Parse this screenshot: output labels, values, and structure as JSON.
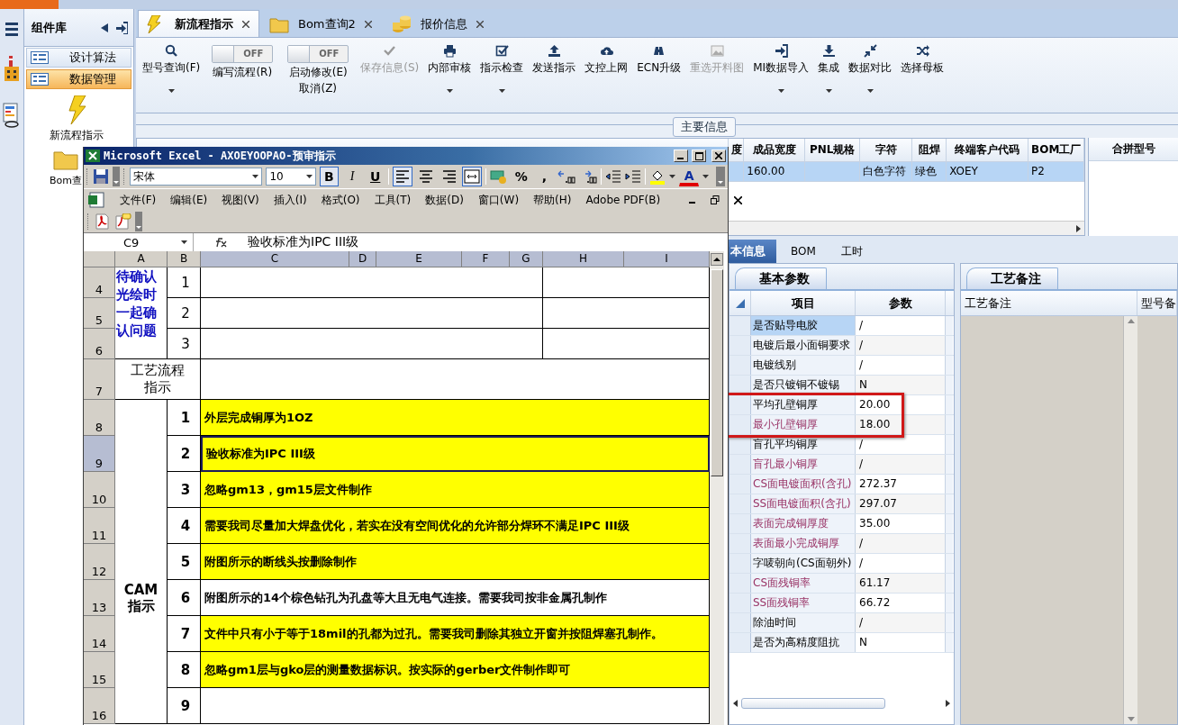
{
  "app_tabs": [
    {
      "label": "新流程指示",
      "selected": true
    },
    {
      "label": "Bom查询2",
      "selected": false
    },
    {
      "label": "报价信息",
      "selected": false
    }
  ],
  "sidebar": {
    "title": "组件库",
    "groups": [
      {
        "label": "设计算法",
        "selected": false
      },
      {
        "label": "数据管理",
        "selected": true
      }
    ],
    "items": [
      {
        "label": "新流程指示"
      },
      {
        "label": "Bom查"
      }
    ]
  },
  "ribbon": [
    {
      "kind": "button",
      "label": "型号查询(F)",
      "disabled": false,
      "dropdown": true
    },
    {
      "kind": "toggle",
      "label": "编写流程(R)",
      "state": "OFF",
      "on": false
    },
    {
      "kind": "toggle",
      "label": "启动修改(E)",
      "sublabel": "取消(Z)",
      "state": "OFF",
      "on": false
    },
    {
      "kind": "button",
      "label": "保存信息(S)",
      "disabled": true,
      "dropdown": false
    },
    {
      "kind": "button",
      "label": "内部审核",
      "disabled": false,
      "dropdown": true
    },
    {
      "kind": "button",
      "label": "指示检查",
      "disabled": false,
      "dropdown": true
    },
    {
      "kind": "button",
      "label": "发送指示",
      "disabled": false,
      "dropdown": false
    },
    {
      "kind": "button",
      "label": "文控上网",
      "disabled": false,
      "dropdown": false
    },
    {
      "kind": "button",
      "label": "ECN升级",
      "disabled": false,
      "dropdown": false
    },
    {
      "kind": "button",
      "label": "重选开料图",
      "disabled": true,
      "dropdown": false
    },
    {
      "kind": "button",
      "label": "MI数据导入",
      "disabled": false,
      "dropdown": true
    },
    {
      "kind": "button",
      "label": "集成",
      "disabled": false,
      "dropdown": true
    },
    {
      "kind": "button",
      "label": "数据对比",
      "disabled": false,
      "dropdown": true
    },
    {
      "kind": "button",
      "label": "选择母板",
      "disabled": false,
      "dropdown": false
    }
  ],
  "main_info": {
    "title": "主要信息",
    "columns": [
      "度",
      "成品宽度",
      "PNL规格",
      "字符",
      "阻焊",
      "终端客户代码",
      "BOM工厂"
    ],
    "rows": [
      {
        "selected": true,
        "cells": [
          null,
          "160.00",
          null,
          "白色字符",
          "绿色",
          "XOEY",
          "P2"
        ]
      }
    ],
    "side_columns": [
      "合拼型号"
    ]
  },
  "lower_tabs": [
    {
      "label": "本信息",
      "selected": true
    },
    {
      "label": "BOM",
      "selected": false
    },
    {
      "label": "工时",
      "selected": false
    }
  ],
  "params": {
    "tab": "基本参数",
    "columns": [
      "项目",
      "参数"
    ],
    "rows": [
      {
        "name": "是否贴导电胶",
        "value": "/",
        "emphasis": false,
        "selected": true,
        "marked": false
      },
      {
        "name": "电镀后最小面铜要求",
        "value": "/",
        "emphasis": false,
        "selected": false,
        "marked": false
      },
      {
        "name": "电镀线别",
        "value": "/",
        "emphasis": false,
        "selected": false,
        "marked": false
      },
      {
        "name": "是否只镀铜不镀锡",
        "value": "N",
        "emphasis": false,
        "selected": false,
        "marked": false
      },
      {
        "name": "平均孔壁铜厚",
        "value": "20.00",
        "emphasis": false,
        "selected": false,
        "marked": true
      },
      {
        "name": "最小孔壁铜厚",
        "value": "18.00",
        "emphasis": true,
        "selected": false,
        "marked": true
      },
      {
        "name": "盲孔平均铜厚",
        "value": "/",
        "emphasis": false,
        "selected": false,
        "marked": false
      },
      {
        "name": "盲孔最小铜厚",
        "value": "/",
        "emphasis": true,
        "selected": false,
        "marked": false
      },
      {
        "name": "CS面电镀面积(含孔)",
        "value": "272.37",
        "emphasis": true,
        "selected": false,
        "marked": false
      },
      {
        "name": "SS面电镀面积(含孔)",
        "value": "297.07",
        "emphasis": true,
        "selected": false,
        "marked": false
      },
      {
        "name": "表面完成铜厚度",
        "value": "35.00",
        "emphasis": true,
        "selected": false,
        "marked": false
      },
      {
        "name": "表面最小完成铜厚",
        "value": "/",
        "emphasis": true,
        "selected": false,
        "marked": false
      },
      {
        "name": "字唛朝向(CS面朝外)",
        "value": "/",
        "emphasis": false,
        "selected": false,
        "marked": false
      },
      {
        "name": "CS面残铜率",
        "value": "61.17",
        "emphasis": true,
        "selected": false,
        "marked": false
      },
      {
        "name": "SS面残铜率",
        "value": "66.72",
        "emphasis": true,
        "selected": false,
        "marked": false
      },
      {
        "name": "除油时间",
        "value": "/",
        "emphasis": false,
        "selected": false,
        "marked": false
      },
      {
        "name": "是否为高精度阻抗",
        "value": "N",
        "emphasis": false,
        "selected": false,
        "marked": false
      }
    ]
  },
  "notes": {
    "tab": "工艺备注",
    "columns": [
      "工艺备注",
      "型号备"
    ]
  },
  "excel": {
    "title": "Microsoft Excel - AXOEYOOPAO-预审指示",
    "font": "宋体",
    "size": "10",
    "format_buttons": [
      {
        "label": "B",
        "on": true
      },
      {
        "label": "I",
        "on": false
      },
      {
        "label": "U",
        "on": false
      }
    ],
    "align_buttons": [
      {
        "on": true
      },
      {
        "on": false
      },
      {
        "on": false
      },
      {
        "on": true
      }
    ],
    "number_keys": [
      "%",
      ","
    ],
    "font_color_key": "A",
    "menus": [
      "文件(F)",
      "编辑(E)",
      "视图(V)",
      "插入(I)",
      "格式(O)",
      "工具(T)",
      "数据(D)",
      "窗口(W)",
      "帮助(H)",
      "Adobe PDF(B)"
    ],
    "name_box": "C9",
    "formula": "验收标准为IPC III级",
    "columns": [
      {
        "label": "A",
        "selected": false
      },
      {
        "label": "B",
        "selected": false
      },
      {
        "label": "C",
        "selected": true
      },
      {
        "label": "D",
        "selected": true
      },
      {
        "label": "E",
        "selected": true
      },
      {
        "label": "F",
        "selected": true
      },
      {
        "label": "G",
        "selected": true
      },
      {
        "label": "H",
        "selected": true
      },
      {
        "label": "I",
        "selected": true
      }
    ],
    "row_numbers": [
      {
        "label": "4",
        "selected": false
      },
      {
        "label": "5",
        "selected": false
      },
      {
        "label": "6",
        "selected": false
      },
      {
        "label": "7",
        "selected": false
      },
      {
        "label": "8",
        "selected": false
      },
      {
        "label": "9",
        "selected": true
      },
      {
        "label": "10",
        "selected": false
      },
      {
        "label": "11",
        "selected": false
      },
      {
        "label": "12",
        "selected": false
      },
      {
        "label": "13",
        "selected": false
      },
      {
        "label": "14",
        "selected": false
      },
      {
        "label": "15",
        "selected": false
      },
      {
        "label": "16",
        "selected": false
      }
    ],
    "sections": [
      {
        "kind": "question",
        "label": "待确认光绘时一起确认问题",
        "items": [
          {
            "no": "1"
          },
          {
            "no": "2"
          },
          {
            "no": "3"
          }
        ]
      },
      {
        "kind": "process",
        "label": "工艺流程指示"
      },
      {
        "kind": "cam",
        "label": "CAM 指示",
        "items": [
          {
            "no": "1",
            "text": "外层完成铜厚为1OZ",
            "highlight": true,
            "selected": false
          },
          {
            "no": "2",
            "text": "验收标准为IPC III级",
            "highlight": true,
            "selected": true
          },
          {
            "no": "3",
            "text": "忽略gm13，gm15层文件制作",
            "highlight": true,
            "selected": false
          },
          {
            "no": "4",
            "text": "需要我司尽量加大焊盘优化，若实在没有空间优化的允许部分焊环不满足IPC III级",
            "highlight": true,
            "selected": false
          },
          {
            "no": "5",
            "text": "附图所示的断线头按删除制作",
            "highlight": true,
            "selected": false
          },
          {
            "no": "6",
            "text": "附图所示的14个棕色钻孔为孔盘等大且无电气连接。需要我司按非金属孔制作",
            "highlight": false,
            "selected": false
          },
          {
            "no": "7",
            "text": "文件中只有小于等于18mil的孔都为过孔。需要我司删除其独立开窗并按阻焊塞孔制作。",
            "highlight": true,
            "selected": false
          },
          {
            "no": "8",
            "text": "忽略gm1层与gko层的测量数据标识。按实际的gerber文件制作即可",
            "highlight": true,
            "selected": false
          },
          {
            "no": "9",
            "highlight": false,
            "selected": false
          }
        ]
      }
    ]
  }
}
